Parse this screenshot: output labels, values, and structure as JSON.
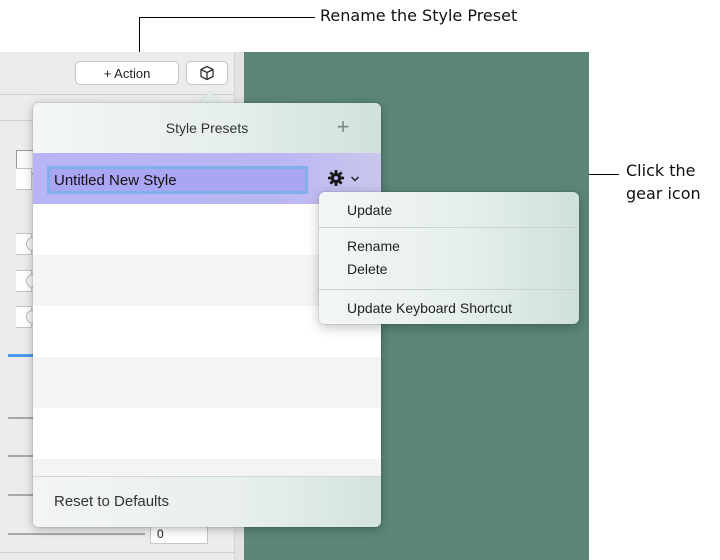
{
  "callouts": {
    "rename": "Rename the Style Preset",
    "gear_line1": "Click the",
    "gear_line2": "gear icon"
  },
  "toolbar": {
    "action_label": "+ Action",
    "cube_icon": "cube-icon"
  },
  "background": {
    "numeric_value": "0",
    "teal_color": "#5b8678"
  },
  "popover": {
    "title": "Style Presets",
    "add_label": "+",
    "editing_name": "Untitled New Style",
    "reset_label": "Reset to Defaults",
    "selection_color": "#b8b4f6"
  },
  "gear_menu": {
    "items": [
      "Update",
      "Rename",
      "Delete",
      "Update Keyboard Shortcut"
    ]
  }
}
